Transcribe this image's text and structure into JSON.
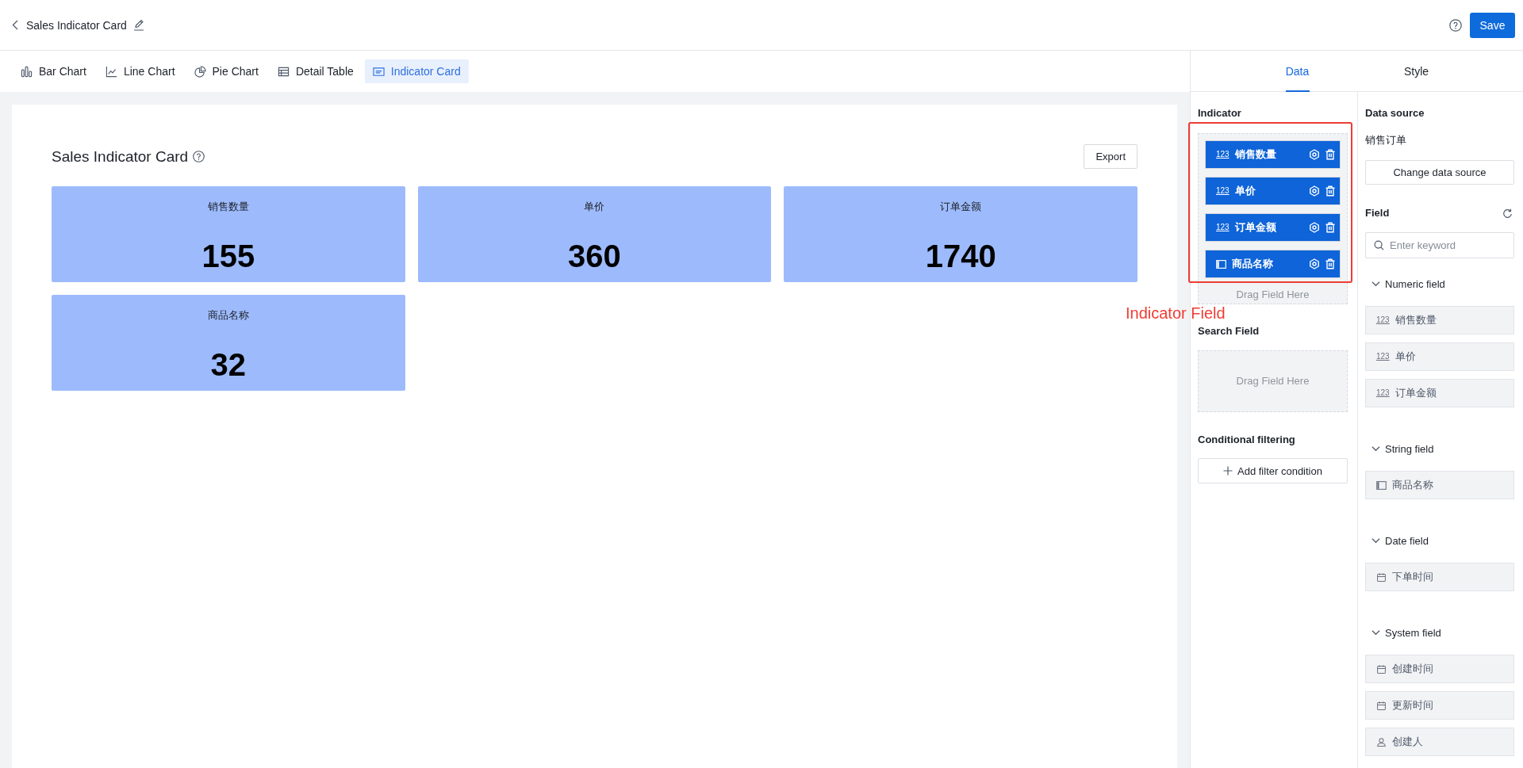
{
  "header": {
    "title": "Sales Indicator Card",
    "save": "Save"
  },
  "chart_types": [
    {
      "kind": "bar",
      "label": "Bar Chart",
      "selected": false
    },
    {
      "kind": "line",
      "label": "Line Chart",
      "selected": false
    },
    {
      "kind": "pie",
      "label": "Pie Chart",
      "selected": false
    },
    {
      "kind": "table",
      "label": "Detail Table",
      "selected": false
    },
    {
      "kind": "card",
      "label": "Indicator Card",
      "selected": true
    }
  ],
  "canvas": {
    "title": "Sales Indicator Card",
    "export": "Export",
    "cards": [
      {
        "label": "销售数量",
        "value": "155"
      },
      {
        "label": "单价",
        "value": "360"
      },
      {
        "label": "订单金额",
        "value": "1740"
      },
      {
        "label": "商品名称",
        "value": "32"
      }
    ]
  },
  "panel_tabs": [
    {
      "label": "Data",
      "selected": true
    },
    {
      "label": "Style",
      "selected": false
    }
  ],
  "indicator": {
    "title": "Indicator",
    "items": [
      {
        "kind": "number",
        "glyph": "123",
        "name": "销售数量"
      },
      {
        "kind": "number",
        "glyph": "123",
        "name": "单价"
      },
      {
        "kind": "number",
        "glyph": "123",
        "name": "订单金额"
      },
      {
        "kind": "string",
        "name": "商品名称"
      }
    ],
    "hint": "Drag Field Here"
  },
  "search_field": {
    "title": "Search Field",
    "hint": "Drag Field Here"
  },
  "filtering": {
    "title": "Conditional filtering",
    "button": "Add filter condition"
  },
  "data_source": {
    "title": "Data source",
    "name": "销售订单",
    "button": "Change data source"
  },
  "fields": {
    "title": "Field",
    "placeholder": "Enter keyword",
    "groups": [
      {
        "title": "Numeric field",
        "expanded": true,
        "items": [
          {
            "kind": "number",
            "glyph": "123",
            "name": "销售数量"
          },
          {
            "kind": "number",
            "glyph": "123",
            "name": "单价"
          },
          {
            "kind": "number",
            "glyph": "123",
            "name": "订单金额"
          }
        ]
      },
      {
        "title": "String field",
        "expanded": true,
        "items": [
          {
            "kind": "string",
            "name": "商品名称"
          }
        ]
      },
      {
        "title": "Date field",
        "expanded": true,
        "items": [
          {
            "kind": "date",
            "name": "下单时间"
          }
        ]
      },
      {
        "title": "System field",
        "expanded": true,
        "items": [
          {
            "kind": "date",
            "name": "创建时间"
          },
          {
            "kind": "date",
            "name": "更新时间"
          },
          {
            "kind": "user",
            "name": "创建人"
          }
        ]
      }
    ]
  },
  "annotation": {
    "label": "Indicator Field"
  }
}
